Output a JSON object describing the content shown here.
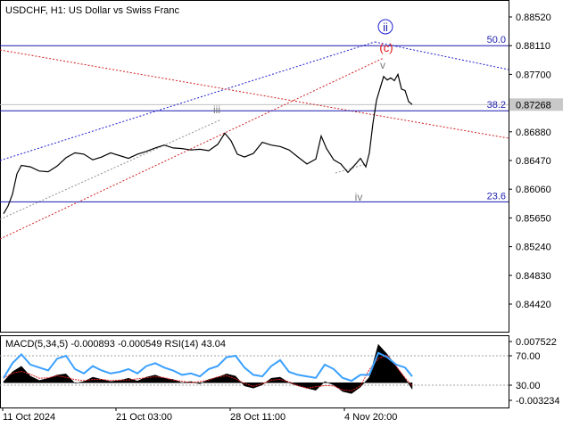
{
  "chart_data": {
    "type": "line",
    "title": "USDCHF, H1:  US Dollar vs Swiss Franc",
    "symbol": "USDCHF",
    "timeframe": "H1",
    "description": "US Dollar vs Swiss Franc",
    "current_price": "0.87268",
    "price_axis": {
      "ticks": [
        "0.88520",
        "0.88110",
        "0.87700",
        "0.87290",
        "0.86880",
        "0.86470",
        "0.86060",
        "0.85650",
        "0.85240",
        "0.84830",
        "0.84420"
      ],
      "ylim": [
        0.8398,
        0.8888
      ]
    },
    "time_axis": {
      "ticks": [
        "11 Oct 2024",
        "21 Oct 03:00",
        "28 Oct 11:00",
        "4 Nov 20:00"
      ]
    },
    "series": [
      {
        "x": [
          0,
          5,
          10,
          15,
          20,
          30,
          40,
          50,
          60,
          70,
          80,
          90,
          100,
          110,
          120,
          130,
          140,
          150,
          160,
          170,
          180,
          190,
          200,
          210,
          220,
          230,
          240,
          248,
          255,
          262,
          270,
          280,
          290,
          300,
          310,
          320,
          330,
          340,
          350,
          356,
          362,
          370,
          378,
          386,
          394,
          400,
          406,
          410,
          414,
          418,
          422,
          426,
          430,
          434,
          438,
          442,
          446,
          450,
          454,
          458
        ],
        "y": [
          0.8571,
          0.8582,
          0.8599,
          0.8628,
          0.864,
          0.8638,
          0.8632,
          0.8631,
          0.8639,
          0.8651,
          0.8658,
          0.8656,
          0.8648,
          0.8652,
          0.8658,
          0.8654,
          0.865,
          0.8656,
          0.866,
          0.8665,
          0.8669,
          0.8665,
          0.8664,
          0.8662,
          0.8663,
          0.8661,
          0.867,
          0.8686,
          0.8675,
          0.8656,
          0.8652,
          0.8657,
          0.8673,
          0.8669,
          0.8667,
          0.8662,
          0.8652,
          0.8642,
          0.8649,
          0.8682,
          0.8664,
          0.8648,
          0.8642,
          0.863,
          0.8641,
          0.865,
          0.8638,
          0.8658,
          0.87,
          0.8733,
          0.875,
          0.8767,
          0.8762,
          0.8765,
          0.8761,
          0.877,
          0.8749,
          0.8747,
          0.8731,
          0.8727
        ]
      }
    ],
    "fib_levels": [
      {
        "label": "50.0",
        "value": 0.8811
      },
      {
        "label": "38.2",
        "value": 0.8718
      },
      {
        "label": "23.6",
        "value": 0.8588
      }
    ],
    "wave_labels": {
      "ii": "ii",
      "c": "(c)",
      "v": "v",
      "iii": "iii",
      "iv": "iv"
    },
    "indicator": {
      "title": "MACD(5,34,5) -0.000893 -0.000549 RSI(14) 43.04",
      "ticks": [
        "0.007522",
        "70.00",
        "30.00",
        "-0.003234"
      ],
      "rsi_ylim": [
        0,
        100
      ],
      "macd_ylim": [
        -0.003234,
        0.007522
      ],
      "rsi": {
        "x": [
          0,
          10,
          20,
          30,
          40,
          50,
          60,
          70,
          80,
          90,
          100,
          110,
          120,
          130,
          140,
          150,
          160,
          170,
          180,
          190,
          200,
          210,
          220,
          230,
          240,
          250,
          260,
          270,
          280,
          290,
          300,
          310,
          320,
          330,
          340,
          350,
          360,
          370,
          380,
          390,
          400,
          410,
          420,
          430,
          440,
          450,
          458
        ],
        "y": [
          40,
          60,
          72,
          58,
          54,
          50,
          66,
          70,
          52,
          46,
          56,
          50,
          46,
          48,
          52,
          46,
          56,
          60,
          54,
          50,
          44,
          46,
          42,
          52,
          56,
          68,
          70,
          54,
          44,
          42,
          56,
          64,
          48,
          44,
          42,
          40,
          58,
          52,
          40,
          36,
          44,
          44,
          74,
          68,
          58,
          54,
          42
        ]
      },
      "macd": {
        "x": [
          0,
          10,
          20,
          30,
          40,
          50,
          60,
          70,
          80,
          90,
          100,
          110,
          120,
          130,
          140,
          150,
          160,
          170,
          180,
          190,
          200,
          210,
          220,
          230,
          240,
          250,
          260,
          270,
          280,
          290,
          300,
          310,
          320,
          330,
          340,
          350,
          360,
          370,
          380,
          390,
          400,
          410,
          420,
          430,
          440,
          450,
          458
        ],
        "y": [
          0.0002,
          0.002,
          0.003,
          0.0012,
          0.0004,
          0.0008,
          0.0014,
          0.0016,
          -0.0001,
          0.0002,
          0.001,
          0.0006,
          0.0002,
          0.0004,
          0.0008,
          0.0003,
          0.001,
          0.0014,
          0.0008,
          0.0006,
          0.0,
          0.0002,
          -0.0002,
          0.0006,
          0.001,
          0.0016,
          0.0012,
          -0.0006,
          -0.001,
          -0.0004,
          0.0008,
          0.001,
          0.0,
          -0.0006,
          -0.001,
          -0.0014,
          0.0002,
          -0.0004,
          -0.0016,
          -0.002,
          -0.0008,
          0.001,
          0.007,
          0.0052,
          0.003,
          0.0008,
          -0.0012
        ]
      }
    }
  }
}
